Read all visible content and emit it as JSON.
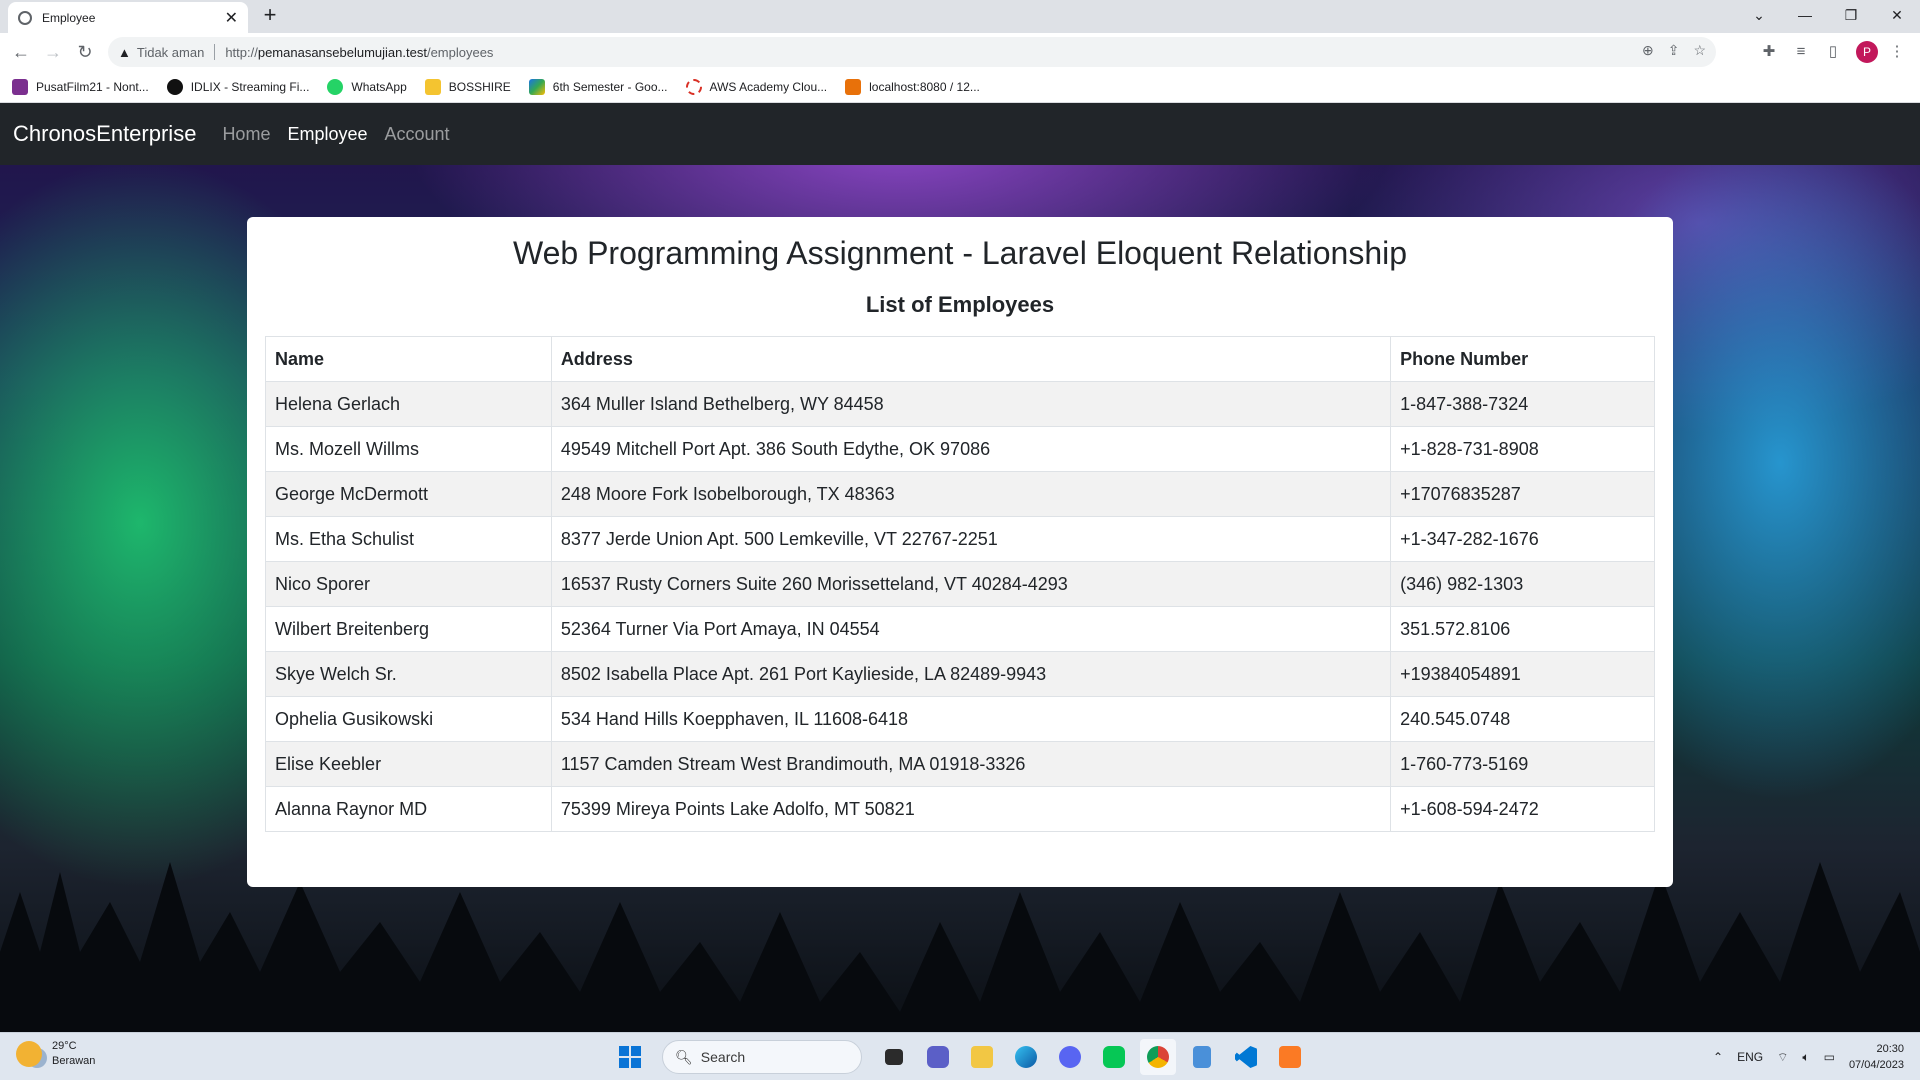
{
  "browser": {
    "tab_title": "Employee",
    "address": {
      "security_label": "Tidak aman",
      "url_protocol": "http://",
      "url_host": "pemanasansebelumujian.test",
      "url_path": "/employees"
    },
    "bookmarks": [
      {
        "label": "PusatFilm21 - Nont...",
        "color": "#7b2f8f"
      },
      {
        "label": "IDLIX - Streaming Fi...",
        "color": "#111111"
      },
      {
        "label": "WhatsApp",
        "color": "#25d366"
      },
      {
        "label": "BOSSHIRE",
        "color": "#f4c430"
      },
      {
        "label": "6th Semester - Goo...",
        "color": "#1a73e8"
      },
      {
        "label": "AWS Academy Clou...",
        "color": "#d93025"
      },
      {
        "label": "localhost:8080 / 12...",
        "color": "#e8710a"
      }
    ],
    "profile_initial": "P"
  },
  "navbar": {
    "brand": "ChronosEnterprise",
    "links": [
      "Home",
      "Employee",
      "Account"
    ]
  },
  "content": {
    "title": "Web Programming Assignment - Laravel Eloquent Relationship",
    "subtitle": "List of Employees",
    "table": {
      "headers": [
        "Name",
        "Address",
        "Phone Number"
      ],
      "rows": [
        [
          "Helena Gerlach",
          "364 Muller Island Bethelberg, WY 84458",
          "1-847-388-7324"
        ],
        [
          "Ms. Mozell Willms",
          "49549 Mitchell Port Apt. 386 South Edythe, OK 97086",
          "+1-828-731-8908"
        ],
        [
          "George McDermott",
          "248 Moore Fork Isobelborough, TX 48363",
          "+17076835287"
        ],
        [
          "Ms. Etha Schulist",
          "8377 Jerde Union Apt. 500 Lemkeville, VT 22767-2251",
          "+1-347-282-1676"
        ],
        [
          "Nico Sporer",
          "16537 Rusty Corners Suite 260 Morissetteland, VT 40284-4293",
          "(346) 982-1303"
        ],
        [
          "Wilbert Breitenberg",
          "52364 Turner Via Port Amaya, IN 04554",
          "351.572.8106"
        ],
        [
          "Skye Welch Sr.",
          "8502 Isabella Place Apt. 261 Port Kaylieside, LA 82489-9943",
          "+19384054891"
        ],
        [
          "Ophelia Gusikowski",
          "534 Hand Hills Koepphaven, IL 11608-6418",
          "240.545.0748"
        ],
        [
          "Elise Keebler",
          "1157 Camden Stream West Brandimouth, MA 01918-3326",
          "1-760-773-5169"
        ],
        [
          "Alanna Raynor MD",
          "75399 Mireya Points Lake Adolfo, MT 50821",
          "+1-608-594-2472"
        ]
      ]
    }
  },
  "taskbar": {
    "weather_temp": "29°C",
    "weather_desc": "Berawan",
    "search_label": "Search",
    "language": "ENG",
    "time": "20:30",
    "date": "07/04/2023"
  }
}
